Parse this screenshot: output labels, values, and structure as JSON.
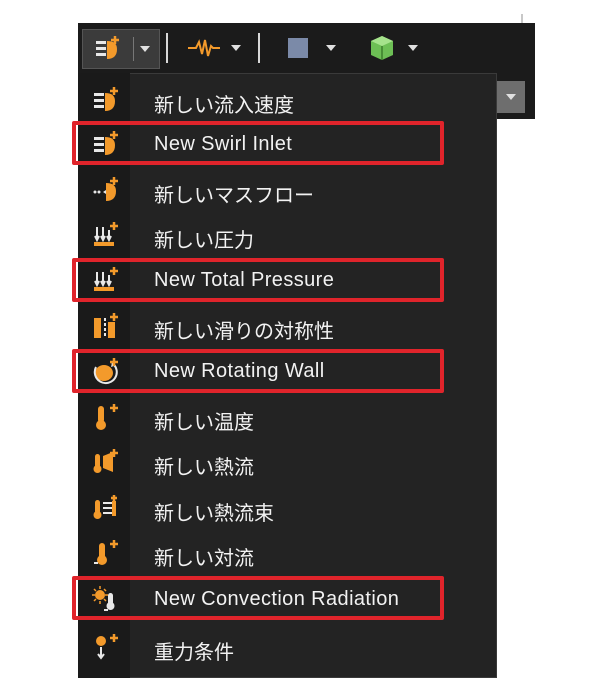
{
  "menu": {
    "items": [
      {
        "label": "新しい流入速度",
        "icon": "inlet-velocity-icon"
      },
      {
        "label": "New Swirl Inlet",
        "icon": "swirl-inlet-icon",
        "highlighted": true
      },
      {
        "label": "新しいマスフロー",
        "icon": "mass-flow-icon"
      },
      {
        "label": "新しい圧力",
        "icon": "pressure-icon"
      },
      {
        "label": "New Total Pressure",
        "icon": "total-pressure-icon",
        "highlighted": true
      },
      {
        "label": "新しい滑りの対称性",
        "icon": "slip-symmetry-icon"
      },
      {
        "label": "New Rotating Wall",
        "icon": "rotating-wall-icon",
        "highlighted": true
      },
      {
        "label": "新しい温度",
        "icon": "temperature-icon"
      },
      {
        "label": "新しい熱流",
        "icon": "heat-flow-icon"
      },
      {
        "label": "新しい熱流束",
        "icon": "heat-flux-icon"
      },
      {
        "label": "新しい対流",
        "icon": "convection-icon"
      },
      {
        "label": "New Convection Radiation",
        "icon": "convection-radiation-icon",
        "highlighted": true
      },
      {
        "label": "重力条件",
        "icon": "gravity-icon"
      }
    ]
  },
  "colors": {
    "accent_orange": "#f39a2b",
    "highlight_red": "#e0242b",
    "menu_bg": "#232323"
  }
}
